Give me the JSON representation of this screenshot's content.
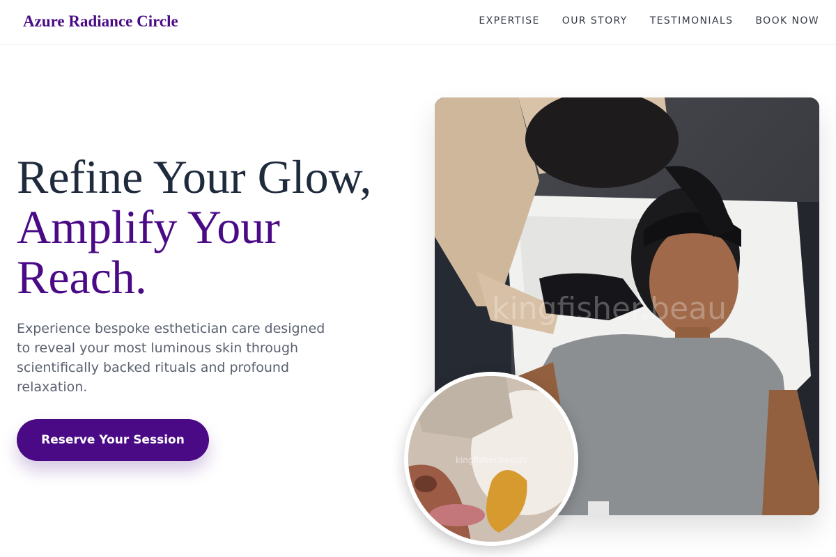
{
  "header": {
    "brand": "Azure Radiance Circle",
    "nav": [
      "EXPERTISE",
      "OUR STORY",
      "TESTIMONIALS",
      "BOOK NOW"
    ]
  },
  "hero": {
    "headline_line1": "Refine Your Glow,",
    "headline_line2": "Amplify Your Reach.",
    "subcopy": "Experience bespoke esthetician care designed to reveal your most luminous skin through scientifically backed rituals and profound relaxation.",
    "cta_label": "Reserve Your Session",
    "main_image_watermark": "kingfisher.beau",
    "inset_image_watermark": "kingfisher.beauty"
  },
  "colors": {
    "accent": "#4a0a86",
    "heading": "#1f2a3c",
    "body": "#5b6170"
  }
}
